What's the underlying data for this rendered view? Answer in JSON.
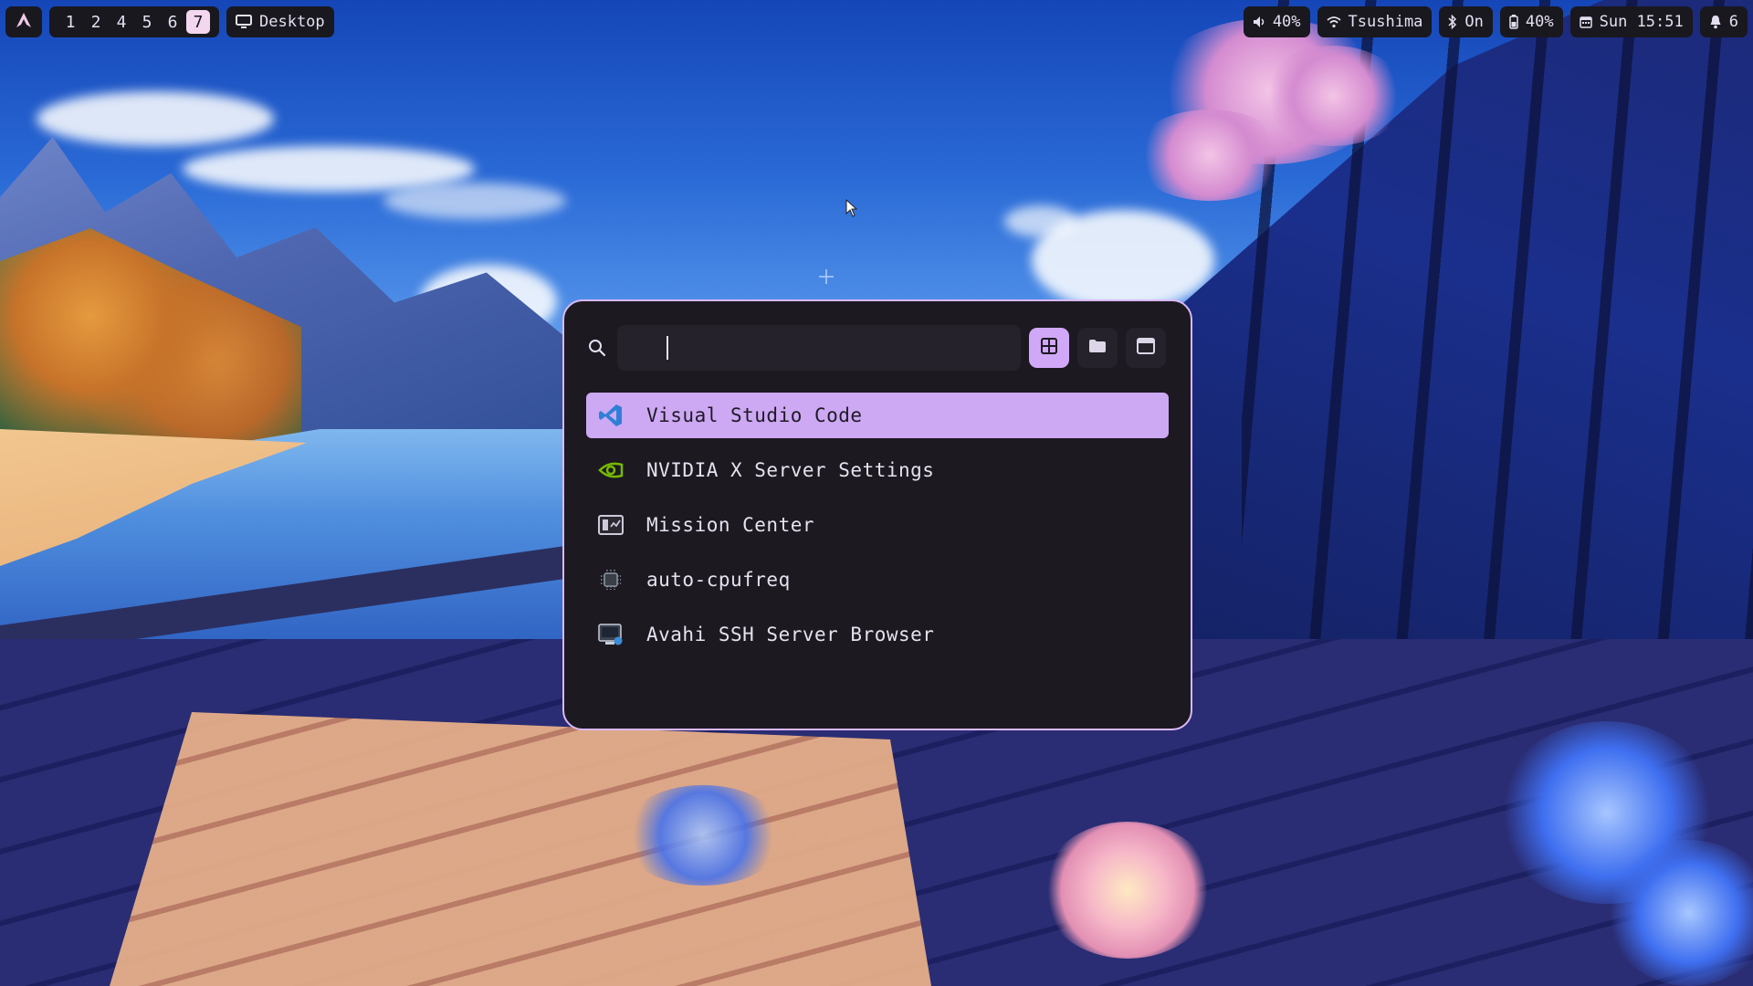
{
  "topbar": {
    "workspaces": [
      {
        "label": "1",
        "active": false
      },
      {
        "label": "2",
        "active": false
      },
      {
        "label": "4",
        "active": false
      },
      {
        "label": "5",
        "active": false
      },
      {
        "label": "6",
        "active": false
      },
      {
        "label": "7",
        "active": true
      }
    ],
    "window_label": "Desktop",
    "volume": "40%",
    "wifi": "Tsushima",
    "bluetooth": "On",
    "battery": "40%",
    "clock": "Sun 15:51",
    "notifications": "6"
  },
  "launcher": {
    "search": {
      "value": "",
      "placeholder": ""
    },
    "modes": [
      {
        "name": "apps-grid-icon",
        "active": true
      },
      {
        "name": "folder-icon",
        "active": false
      },
      {
        "name": "window-icon",
        "active": false
      }
    ],
    "results": [
      {
        "label": "Visual Studio Code",
        "icon": "vscode-icon",
        "selected": true
      },
      {
        "label": "NVIDIA X Server Settings",
        "icon": "nvidia-icon",
        "selected": false
      },
      {
        "label": "Mission Center",
        "icon": "mission-center-icon",
        "selected": false
      },
      {
        "label": "auto-cpufreq",
        "icon": "cpu-icon",
        "selected": false
      },
      {
        "label": "Avahi SSH Server Browser",
        "icon": "avahi-icon",
        "selected": false
      }
    ]
  },
  "colors": {
    "accent": "#cda8f3",
    "launcher_bg": "#1c1921",
    "bar_pill_bg": "#19181f",
    "active_workspace": "#f3d7ee"
  }
}
